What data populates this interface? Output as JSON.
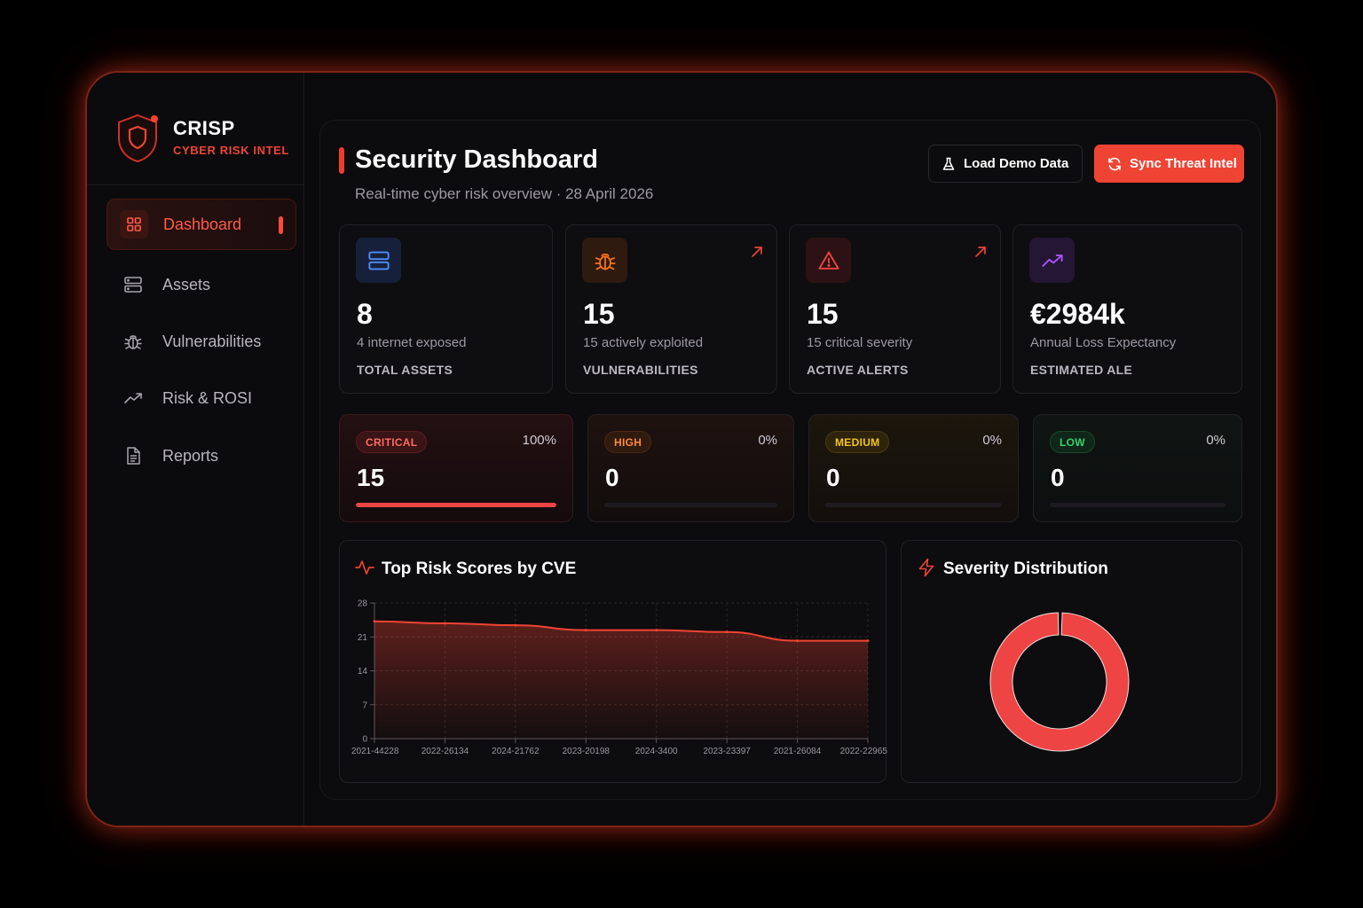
{
  "brand": {
    "title": "CRISP",
    "subtitle": "CYBER RISK INTEL"
  },
  "nav": [
    {
      "label": "Dashboard",
      "icon": "grid-icon",
      "active": true
    },
    {
      "label": "Assets",
      "icon": "server-icon"
    },
    {
      "label": "Vulnerabilities",
      "icon": "bug-icon"
    },
    {
      "label": "Risk & ROSI",
      "icon": "trend-icon"
    },
    {
      "label": "Reports",
      "icon": "document-icon"
    }
  ],
  "header": {
    "title": "Security Dashboard",
    "subtitle": "Real-time cyber risk overview · 28 April 2026",
    "demo_button": "Load Demo Data",
    "sync_button": "Sync Threat Intel"
  },
  "stats": [
    {
      "value": "8",
      "sub": "4 internet exposed",
      "label": "TOTAL ASSETS",
      "icon": "server-icon",
      "color": "#3b82f6"
    },
    {
      "value": "15",
      "sub": "15 actively exploited",
      "label": "VULNERABILITIES",
      "icon": "bug-icon",
      "color": "#f97316"
    },
    {
      "value": "15",
      "sub": "15 critical severity",
      "label": "ACTIVE ALERTS",
      "icon": "alert-icon",
      "color": "#ef4444"
    },
    {
      "value": "€2984k",
      "sub": "Annual Loss Expectancy",
      "label": "ESTIMATED ALE",
      "icon": "trend-icon",
      "color": "#a855f7"
    }
  ],
  "severity": [
    {
      "label": "CRITICAL",
      "pct": "100%",
      "count": "15",
      "fill": 1.0,
      "color": "#ef4444"
    },
    {
      "label": "HIGH",
      "pct": "0%",
      "count": "0",
      "fill": 0.0,
      "color": "#f97316"
    },
    {
      "label": "MEDIUM",
      "pct": "0%",
      "count": "0",
      "fill": 0.0,
      "color": "#eab308"
    },
    {
      "label": "LOW",
      "pct": "0%",
      "count": "0",
      "fill": 0.0,
      "color": "#22c55e"
    }
  ],
  "panels": {
    "risk_title": "Top Risk Scores by CVE",
    "severity_title": "Severity Distribution"
  },
  "chart_data": [
    {
      "type": "area",
      "title": "Top Risk Scores by CVE",
      "categories": [
        "2021-44228",
        "2022-26134",
        "2024-21762",
        "2023-20198",
        "2024-3400",
        "2023-23397",
        "2021-26084",
        "2022-22965"
      ],
      "values": [
        24.2,
        23.8,
        23.4,
        22.4,
        22.4,
        22.0,
        20.2,
        20.2
      ],
      "ylim": [
        0,
        28
      ],
      "yticks": [
        0,
        7,
        14,
        21,
        28
      ],
      "grid": true,
      "color": "#ef4434"
    },
    {
      "type": "pie",
      "title": "Severity Distribution",
      "categories": [
        "CRITICAL",
        "HIGH",
        "MEDIUM",
        "LOW"
      ],
      "values": [
        15,
        0,
        0,
        0
      ],
      "color": "#ef4444"
    }
  ]
}
